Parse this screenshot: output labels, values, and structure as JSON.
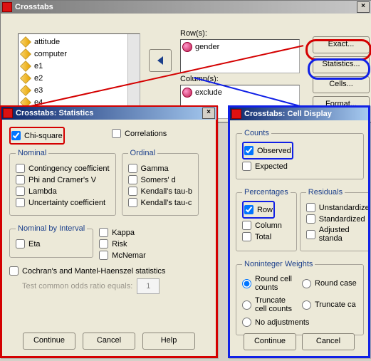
{
  "main": {
    "title": "Crosstabs",
    "variables": [
      "attitude",
      "computer",
      "e1",
      "e2",
      "e3",
      "e4"
    ],
    "rows_label": "Row(s):",
    "rows_value": "gender",
    "cols_label": "Column(s):",
    "cols_value": "exclude",
    "buttons": {
      "exact": "Exact...",
      "statistics": "Statistics...",
      "cells": "Cells...",
      "format": "Format..."
    }
  },
  "stats": {
    "title": "Crosstabs: Statistics",
    "chi_square": "Chi-square",
    "correlations": "Correlations",
    "nominal": {
      "legend": "Nominal",
      "contingency": "Contingency coefficient",
      "phi": "Phi and Cramer's V",
      "lambda": "Lambda",
      "uncertainty": "Uncertainty coefficient"
    },
    "ordinal": {
      "legend": "Ordinal",
      "gamma": "Gamma",
      "somers": "Somers' d",
      "ktau_b": "Kendall's tau-b",
      "ktau_c": "Kendall's tau-c"
    },
    "nominal_by_interval": {
      "legend": "Nominal by Interval",
      "eta": "Eta"
    },
    "other": {
      "kappa": "Kappa",
      "risk": "Risk",
      "mcnemar": "McNemar"
    },
    "cochran": "Cochran's and Mantel-Haenszel statistics",
    "odds_label": "Test common odds ratio equals:",
    "odds_value": "1",
    "continue": "Continue",
    "cancel": "Cancel",
    "help": "Help"
  },
  "cells": {
    "title": "Crosstabs: Cell Display",
    "counts": {
      "legend": "Counts",
      "observed": "Observed",
      "expected": "Expected"
    },
    "percentages": {
      "legend": "Percentages",
      "row": "Row",
      "column": "Column",
      "total": "Total"
    },
    "residuals": {
      "legend": "Residuals",
      "unstd": "Unstandardized",
      "std": "Standardized",
      "adj": "Adjusted standa"
    },
    "noninteger": {
      "legend": "Noninteger Weights",
      "round_cell": "Round cell counts",
      "round_case": "Round case",
      "trunc_cell": "Truncate cell counts",
      "trunc_case": "Truncate ca",
      "none": "No adjustments"
    },
    "continue": "Continue",
    "cancel": "Cancel"
  }
}
